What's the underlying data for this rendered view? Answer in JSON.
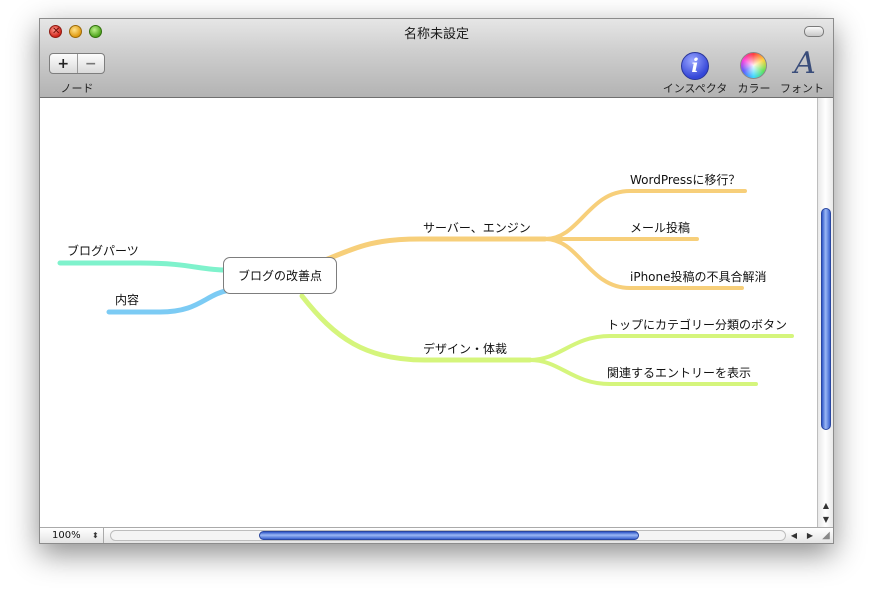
{
  "window": {
    "title": "名称未設定"
  },
  "toolbar": {
    "add_label": "+",
    "remove_label": "−",
    "node_label": "ノード",
    "inspector_label": "インスペクタ",
    "color_label": "カラー",
    "font_label": "フォント",
    "inspector_glyph": "i",
    "font_glyph": "A"
  },
  "mindmap": {
    "root": "ブログの改善点",
    "left": [
      "ブログパーツ",
      "内容"
    ],
    "branch_server": {
      "label": "サーバー、エンジン",
      "children": [
        "WordPressに移行？",
        "メール投稿",
        "iPhone投稿の不具合解消"
      ]
    },
    "branch_design": {
      "label": "デザイン・体裁",
      "children": [
        "トップにカテゴリー分類のボタン",
        "関連するエントリーを表示"
      ]
    },
    "colors": {
      "teal": "#7ff2cc",
      "blue": "#7ccbf4",
      "orange": "#f7cf7a",
      "lime": "#d5f57c"
    }
  },
  "statusbar": {
    "zoom": "100%"
  }
}
